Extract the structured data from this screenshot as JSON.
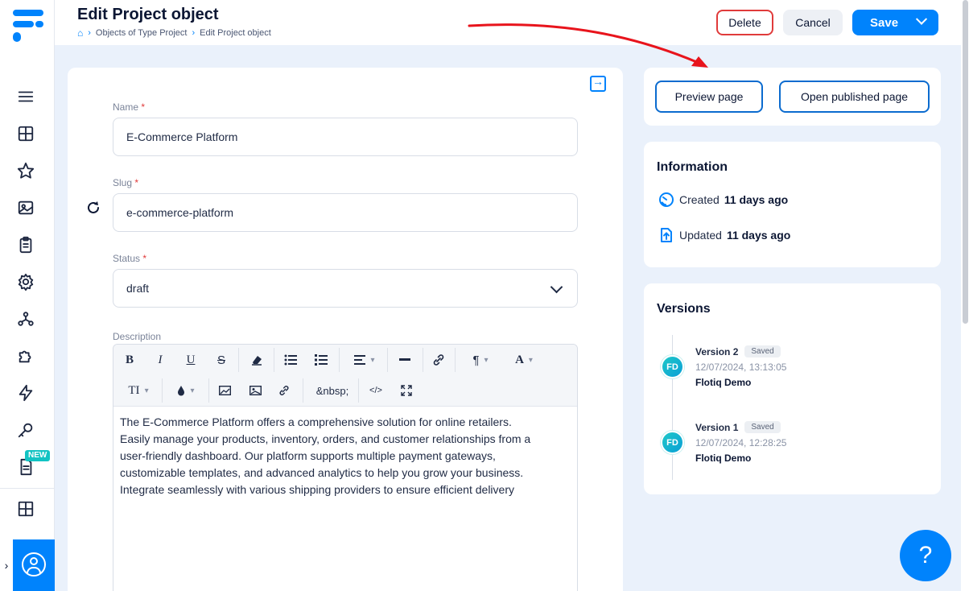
{
  "header": {
    "title": "Edit Project object",
    "breadcrumb": [
      "Objects of Type Project",
      "Edit Project object"
    ],
    "delete_label": "Delete",
    "cancel_label": "Cancel",
    "save_label": "Save"
  },
  "sidebar": {
    "new_badge": "NEW",
    "items": [
      "menu-icon",
      "grid-icon",
      "star-icon",
      "image-icon",
      "clipboard-icon",
      "gear-icon",
      "network-icon",
      "puzzle-icon",
      "lightning-icon",
      "key-icon",
      "document-icon",
      "layout-icon"
    ]
  },
  "form": {
    "name_label": "Name",
    "name_value": "E-Commerce Platform",
    "slug_label": "Slug",
    "slug_value": "e-commerce-platform",
    "status_label": "Status",
    "status_value": "draft",
    "required_mark": "*",
    "description_label": "Description",
    "description_lines": [
      "The E-Commerce Platform offers a comprehensive solution for online retailers.",
      "Easily manage your products, inventory, orders, and customer relationships from a",
      "user-friendly dashboard. Our platform supports multiple payment gateways,",
      "customizable templates, and advanced analytics to help you grow your business.",
      "Integrate seamlessly with various shipping providers to ensure efficient delivery"
    ],
    "toolbar": {
      "bold": "B",
      "italic": "I",
      "underline": "U",
      "strike": "S",
      "paragraph": "¶",
      "font_color": "A",
      "font_size": "TI",
      "nbsp": "&nbsp;",
      "code": "</>"
    }
  },
  "actions": {
    "preview_label": "Preview page",
    "open_published_label": "Open published page"
  },
  "information": {
    "title": "Information",
    "created_label": "Created",
    "created_value": "11 days ago",
    "updated_label": "Updated",
    "updated_value": "11 days ago"
  },
  "versions": {
    "title": "Versions",
    "items": [
      {
        "title": "Version 2",
        "badge": "Saved",
        "date": "12/07/2024, 13:13:05",
        "author": "Flotiq Demo",
        "initials": "FD"
      },
      {
        "title": "Version 1",
        "badge": "Saved",
        "date": "12/07/2024, 12:28:25",
        "author": "Flotiq Demo",
        "initials": "FD"
      }
    ]
  },
  "help": {
    "label": "?"
  },
  "colors": {
    "accent": "#0083fc",
    "danger": "#e03b3b",
    "annotation_arrow": "#e8141c"
  }
}
